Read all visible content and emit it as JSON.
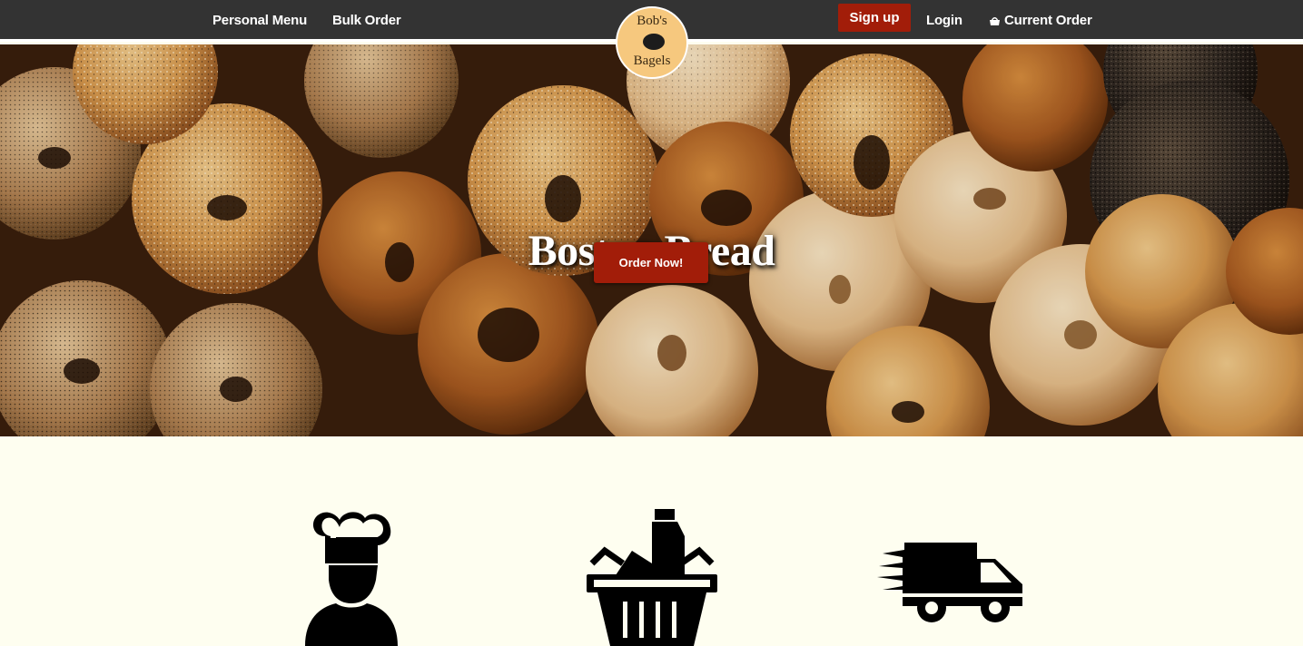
{
  "nav": {
    "personal_menu": "Personal Menu",
    "bulk_order": "Bulk Order",
    "signup": "Sign up",
    "login": "Login",
    "current_order": "Current Order"
  },
  "logo": {
    "line1": "Bob's",
    "line2": "Bagels"
  },
  "hero": {
    "title": "Boston Bread",
    "button": "Order Now!"
  },
  "features": {
    "icons": [
      "chef-icon",
      "grocery-basket-icon",
      "delivery-truck-icon"
    ]
  },
  "colors": {
    "navbar": "#333333",
    "accent": "#a21d09",
    "logo": "#f6c87e",
    "page_background": "#fefef0"
  }
}
